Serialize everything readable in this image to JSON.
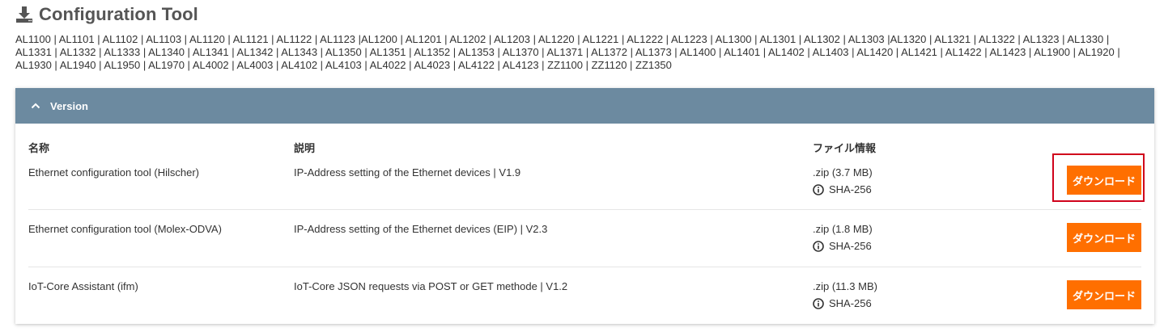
{
  "page": {
    "title": "Configuration Tool",
    "devices": "AL1100 | AL1101 | AL1102 | AL1103 | AL1120 | AL1121 | AL1122 | AL1123 |AL1200 | AL1201 | AL1202 | AL1203 | AL1220 | AL1221 | AL1222 | AL1223 | AL1300 | AL1301 | AL1302 | AL1303 |AL1320 | AL1321 | AL1322 | AL1323 | AL1330 | AL1331 | AL1332 | AL1333 | AL1340 | AL1341 | AL1342 | AL1343 | AL1350 | AL1351 | AL1352 | AL1353 | AL1370 | AL1371 | AL1372 | AL1373 | AL1400 | AL1401 | AL1402 | AL1403 | AL1420 | AL1421 | AL1422 | AL1423 | AL1900 | AL1920 | AL1930 | AL1940 | AL1950 | AL1970 | AL4002 | AL4003 | AL4102 | AL4103 | AL4022 | AL4023 | AL4122 | AL4123 | ZZ1100 | ZZ1120 | ZZ1350"
  },
  "panel": {
    "header": "Version",
    "columns": {
      "name": "名称",
      "description": "説明",
      "file_info": "ファイル情報"
    },
    "rows": [
      {
        "name": "Ethernet configuration tool (Hilscher)",
        "description": "IP-Address setting of the Ethernet devices | V1.9",
        "size": ".zip (3.7 MB)",
        "hash": "SHA-256",
        "button": "ダウンロード"
      },
      {
        "name": "Ethernet configuration tool (Molex-ODVA)",
        "description": "IP-Address setting of the Ethernet devices (EIP) | V2.3",
        "size": ".zip (1.8 MB)",
        "hash": "SHA-256",
        "button": "ダウンロード"
      },
      {
        "name": "IoT-Core Assistant (ifm)",
        "description": "IoT-Core JSON requests via POST or GET methode | V1.2",
        "size": ".zip (11.3 MB)",
        "hash": "SHA-256",
        "button": "ダウンロード"
      }
    ]
  },
  "colors": {
    "header_bg": "#6c8aa0",
    "button_bg": "#ff6f00",
    "highlight": "#d0021b"
  }
}
